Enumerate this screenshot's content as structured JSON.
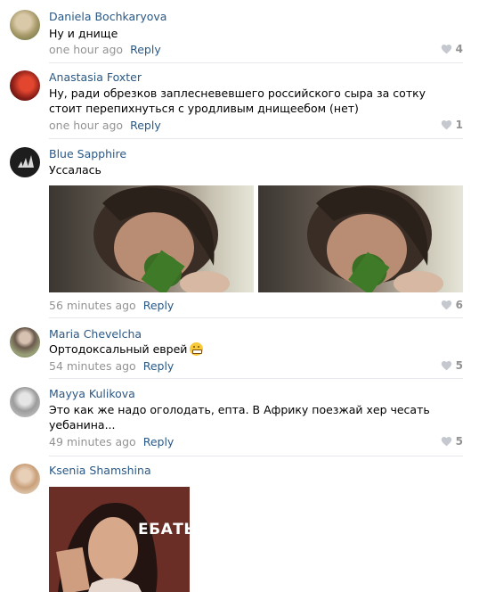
{
  "comments": [
    {
      "author": "Daniela Bochkaryova",
      "text": "Ну и днище",
      "time": "one hour ago",
      "reply": "Reply",
      "likes": "4"
    },
    {
      "author": "Anastasia Foxter",
      "text": "Ну, ради обрезков заплесневевшего российского сыра за сотку стоит перепихнуться с уродливым днищеебом (нет)",
      "time": "one hour ago",
      "reply": "Reply",
      "likes": "1"
    },
    {
      "author": "Blue Sapphire",
      "text": "Уссалась",
      "time": "56 minutes ago",
      "reply": "Reply",
      "likes": "6"
    },
    {
      "author": "Maria Chevelcha",
      "text": "Ортодоксальный еврей",
      "emoji": "grimacing-face",
      "time": "54 minutes ago",
      "reply": "Reply",
      "likes": "5"
    },
    {
      "author": "Mayya Kulikova",
      "text": "Это как же надо оголодать, епта. В Африку поезжай хер чесать уебанина...",
      "time": "49 minutes ago",
      "reply": "Reply",
      "likes": "5"
    },
    {
      "author": "Ksenia Shamshina",
      "image_caption": "ЕБАТЬ"
    }
  ],
  "icons": {
    "like": "heart-icon"
  },
  "colors": {
    "link": "#2a5885",
    "meta": "#939393",
    "divider": "#e7e8ec"
  }
}
